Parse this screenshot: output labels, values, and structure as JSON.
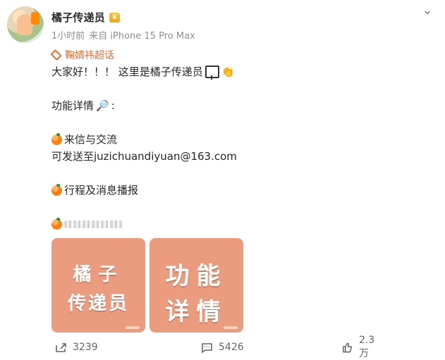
{
  "post": {
    "author": {
      "name": "橘子传递员",
      "badge": "vip-crown-icon"
    },
    "meta": {
      "time": "1小时前",
      "source": "来自 iPhone 15 Pro Max"
    },
    "topic": "鞠婧祎超话",
    "lines": [
      "大家好！！！ 这里是橘子传递员",
      "",
      "功能详情",
      "",
      "来信与交流",
      "可发送至juzichuandiyuan@163.com",
      "",
      "行程及消息播报",
      ""
    ],
    "icons": {
      "more": "chevron-down-icon",
      "topic": "diamond-icon",
      "orange": "orange-emoji-icon",
      "sign": "sign-emoji-icon",
      "clap": "clap-emoji-icon",
      "search": "magnifier-emoji-icon",
      "share": "share-icon",
      "comment": "comment-icon",
      "like": "like-icon"
    },
    "images": [
      {
        "line1": "橘子",
        "line2": "传递员"
      },
      {
        "line1": "功能",
        "line2": "详情"
      }
    ],
    "stats": {
      "shares": "3239",
      "comments": "5426",
      "likes": "2.3万"
    },
    "colors": {
      "topic": "#ea6a2f",
      "image_bg": "#eb9c7f",
      "text": "#262626",
      "muted": "#8f8f8f"
    }
  }
}
